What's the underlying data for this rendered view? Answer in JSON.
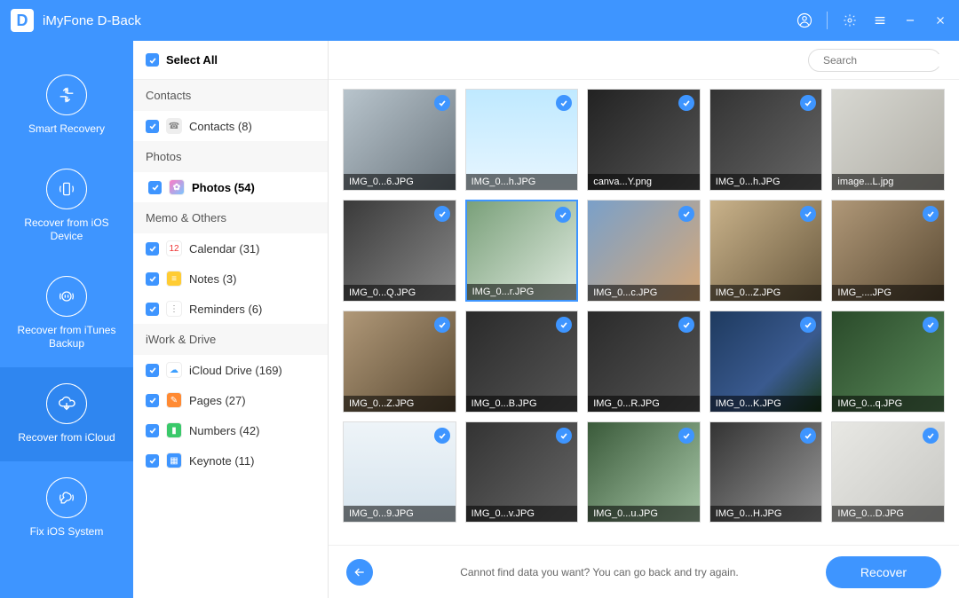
{
  "titlebar": {
    "app_name": "iMyFone D-Back",
    "logo_letter": "D"
  },
  "nav": {
    "items": [
      {
        "label": "Smart Recovery",
        "active": false
      },
      {
        "label": "Recover from iOS Device",
        "active": false
      },
      {
        "label": "Recover from iTunes Backup",
        "active": false
      },
      {
        "label": "Recover from iCloud",
        "active": true
      },
      {
        "label": "Fix iOS System",
        "active": false
      }
    ]
  },
  "select_all": {
    "label": "Select All",
    "checked": true
  },
  "categories": [
    {
      "header": "Contacts",
      "items": [
        {
          "label": "Contacts (8)",
          "checked": true,
          "active": false,
          "iconbg": "#eee",
          "iconfg": "#888",
          "glyph": "☎"
        }
      ]
    },
    {
      "header": "Photos",
      "items": [
        {
          "label": "Photos (54)",
          "checked": true,
          "active": true,
          "iconbg": "linear-gradient(135deg,#ff7ac6,#7ac6ff)",
          "iconfg": "#fff",
          "glyph": "✿"
        }
      ]
    },
    {
      "header": "Memo & Others",
      "items": [
        {
          "label": "Calendar (31)",
          "checked": true,
          "active": false,
          "iconbg": "#fff",
          "iconfg": "#e33",
          "glyph": "12"
        },
        {
          "label": "Notes (3)",
          "checked": true,
          "active": false,
          "iconbg": "#ffcc33",
          "iconfg": "#fff",
          "glyph": "≡"
        },
        {
          "label": "Reminders (6)",
          "checked": true,
          "active": false,
          "iconbg": "#fff",
          "iconfg": "#888",
          "glyph": "⋮"
        }
      ]
    },
    {
      "header": "iWork & Drive",
      "items": [
        {
          "label": "iCloud Drive (169)",
          "checked": true,
          "active": false,
          "iconbg": "#fff",
          "iconfg": "#3ea0ff",
          "glyph": "☁"
        },
        {
          "label": "Pages (27)",
          "checked": true,
          "active": false,
          "iconbg": "#ff8a33",
          "iconfg": "#fff",
          "glyph": "✎"
        },
        {
          "label": "Numbers (42)",
          "checked": true,
          "active": false,
          "iconbg": "#3ac96a",
          "iconfg": "#fff",
          "glyph": "▮"
        },
        {
          "label": "Keynote (11)",
          "checked": true,
          "active": false,
          "iconbg": "#3e95ff",
          "iconfg": "#fff",
          "glyph": "▦"
        }
      ]
    }
  ],
  "search": {
    "placeholder": "Search"
  },
  "thumbs": [
    {
      "label": "IMG_0...6.JPG",
      "checked": true,
      "selected": false,
      "bg": "bg0"
    },
    {
      "label": "IMG_0...h.JPG",
      "checked": true,
      "selected": false,
      "bg": "bg1"
    },
    {
      "label": "canva...Y.png",
      "checked": true,
      "selected": false,
      "bg": "bg2"
    },
    {
      "label": "IMG_0...h.JPG",
      "checked": true,
      "selected": false,
      "bg": "bg3"
    },
    {
      "label": "image...L.jpg",
      "checked": false,
      "selected": false,
      "bg": "bg4"
    },
    {
      "label": "IMG_0...Q.JPG",
      "checked": true,
      "selected": false,
      "bg": "bg5"
    },
    {
      "label": "IMG_0...r.JPG",
      "checked": true,
      "selected": true,
      "bg": "bg6"
    },
    {
      "label": "IMG_0...c.JPG",
      "checked": true,
      "selected": false,
      "bg": "bg7"
    },
    {
      "label": "IMG_0...Z.JPG",
      "checked": true,
      "selected": false,
      "bg": "bg8"
    },
    {
      "label": "IMG_....JPG",
      "checked": true,
      "selected": false,
      "bg": "bg9"
    },
    {
      "label": "IMG_0...Z.JPG",
      "checked": true,
      "selected": false,
      "bg": "bg9"
    },
    {
      "label": "IMG_0...B.JPG",
      "checked": true,
      "selected": false,
      "bg": "bg10"
    },
    {
      "label": "IMG_0...R.JPG",
      "checked": true,
      "selected": false,
      "bg": "bg10"
    },
    {
      "label": "IMG_0...K.JPG",
      "checked": true,
      "selected": false,
      "bg": "bg11"
    },
    {
      "label": "IMG_0...q.JPG",
      "checked": true,
      "selected": false,
      "bg": "bg12"
    },
    {
      "label": "IMG_0...9.JPG",
      "checked": true,
      "selected": false,
      "bg": "bg13"
    },
    {
      "label": "IMG_0...v.JPG",
      "checked": true,
      "selected": false,
      "bg": "bg14"
    },
    {
      "label": "IMG_0...u.JPG",
      "checked": true,
      "selected": false,
      "bg": "bg15"
    },
    {
      "label": "IMG_0...H.JPG",
      "checked": true,
      "selected": false,
      "bg": "bg16"
    },
    {
      "label": "IMG_0...D.JPG",
      "checked": true,
      "selected": false,
      "bg": "bg17"
    }
  ],
  "footer": {
    "message": "Cannot find data you want? You can go back and try again.",
    "recover_label": "Recover"
  }
}
